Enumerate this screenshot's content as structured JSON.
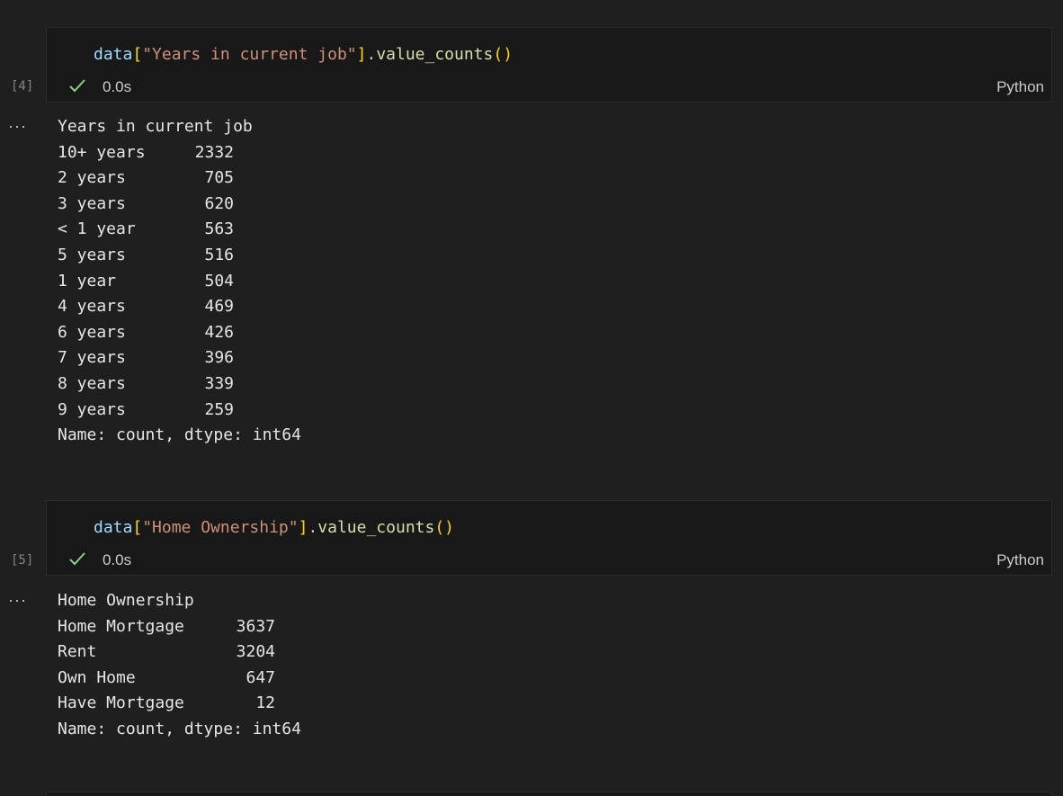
{
  "cells": [
    {
      "exec_count": "[4]",
      "code": {
        "var": "data",
        "open_bracket": "[",
        "string": "\"Years in current job\"",
        "close_bracket": "]",
        "dot": ".",
        "method": "value_counts",
        "parens": "()"
      },
      "status_time": "0.0s",
      "language": "Python",
      "output": {
        "header": "Years in current job",
        "rows": [
          {
            "label": "10+ years",
            "value": "2332"
          },
          {
            "label": "2 years",
            "value": "705"
          },
          {
            "label": "3 years",
            "value": "620"
          },
          {
            "label": "< 1 year",
            "value": "563"
          },
          {
            "label": "5 years",
            "value": "516"
          },
          {
            "label": "1 year",
            "value": "504"
          },
          {
            "label": "4 years",
            "value": "469"
          },
          {
            "label": "6 years",
            "value": "426"
          },
          {
            "label": "7 years",
            "value": "396"
          },
          {
            "label": "8 years",
            "value": "339"
          },
          {
            "label": "9 years",
            "value": "259"
          }
        ],
        "footer": "Name: count, dtype: int64"
      }
    },
    {
      "exec_count": "[5]",
      "code": {
        "var": "data",
        "open_bracket": "[",
        "string": "\"Home Ownership\"",
        "close_bracket": "]",
        "dot": ".",
        "method": "value_counts",
        "parens": "()"
      },
      "status_time": "0.0s",
      "language": "Python",
      "output": {
        "header": "Home Ownership",
        "rows": [
          {
            "label": "Home Mortgage",
            "value": "3637"
          },
          {
            "label": "Rent",
            "value": "3204"
          },
          {
            "label": "Own Home",
            "value": "647"
          },
          {
            "label": "Have Mortgage",
            "value": "12"
          }
        ],
        "footer": "Name: count, dtype: int64"
      }
    }
  ],
  "ellipsis_glyph": "···",
  "colors": {
    "background": "#1f1f1f",
    "cell_background": "#181818",
    "success_check": "#89d185",
    "string": "#ce9178",
    "variable": "#9cdcfe",
    "function": "#dcdcaa",
    "bracket": "#ffd700"
  }
}
